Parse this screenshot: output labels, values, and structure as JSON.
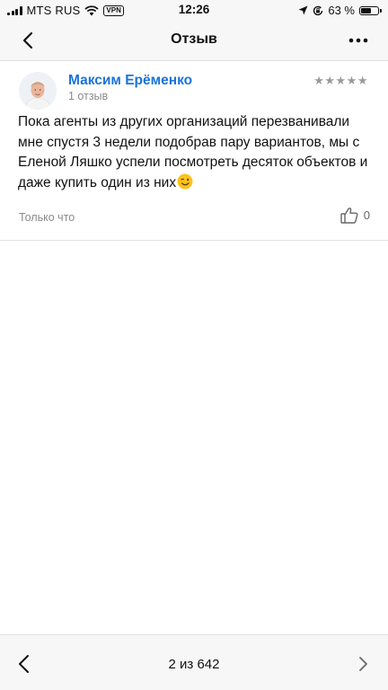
{
  "status_bar": {
    "carrier": "MTS RUS",
    "vpn_label": "VPN",
    "time": "12:26",
    "battery": "63 %",
    "battery_level": 0.63,
    "icons": [
      "signal-icon",
      "wifi-icon",
      "location-icon",
      "rotation-lock-icon",
      "battery-icon"
    ]
  },
  "nav": {
    "title": "Отзыв",
    "back_icon": "chevron-left-icon",
    "more_icon": "more-dots-icon"
  },
  "review": {
    "author": "Максим Ерёменко",
    "review_count": "1 отзыв",
    "rating_stars": "★★★★★",
    "rating_value": 5,
    "text": "Пока агенты из других организаций перезванивали мне спустя 3 недели подобрав пару вариантов, мы с Еленой Ляшко успели посмотреть десяток объектов и даже купить один из них",
    "emoji_icon": "winking-face-emoji",
    "date": "Только что",
    "likes": "0",
    "like_icon": "thumbs-up-icon"
  },
  "pager": {
    "label": "2 из 642",
    "prev_icon": "chevron-left-icon",
    "next_icon": "chevron-right-icon"
  },
  "colors": {
    "accent": "#1a73d9",
    "muted_text": "#8a8a8a",
    "bar_background": "#f7f7f7"
  }
}
